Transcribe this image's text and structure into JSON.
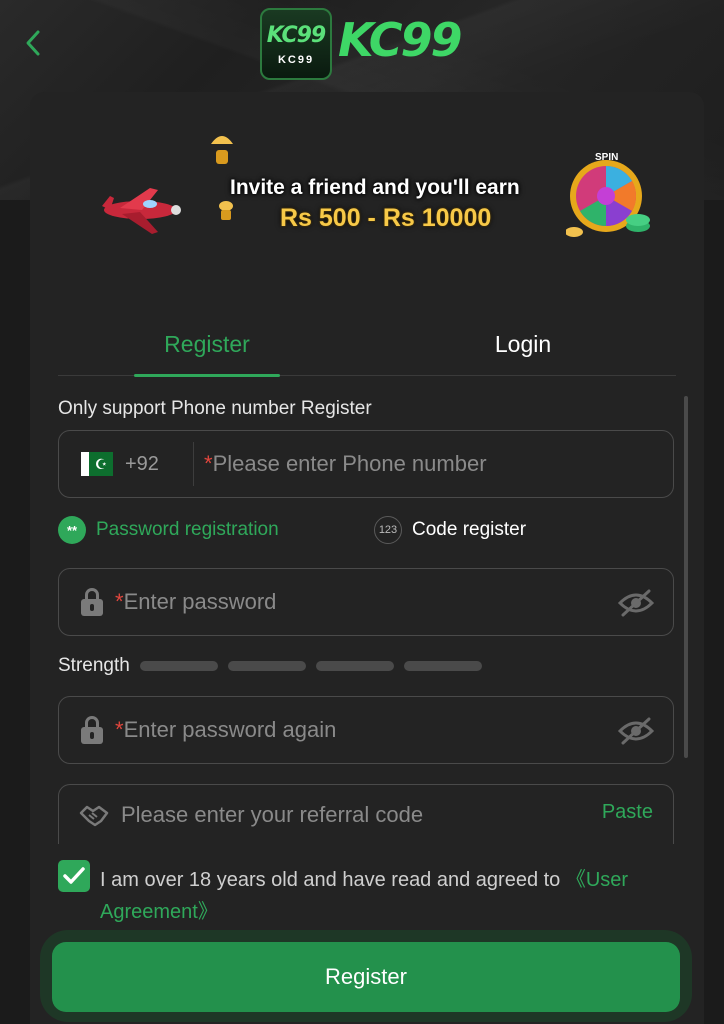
{
  "header": {
    "back_icon": "chevron-left-icon",
    "logo_badge": "KC99",
    "logo_badge_sub": "KC99",
    "logo_text": "KC99"
  },
  "banner": {
    "line1": "Invite a friend and you'll earn",
    "line2": "Rs 500 - Rs 10000",
    "wheel_label": "SPIN"
  },
  "tabs": [
    {
      "label": "Register",
      "active": true
    },
    {
      "label": "Login",
      "active": false
    }
  ],
  "form": {
    "section_label": "Only support Phone number Register",
    "phone": {
      "country_code": "+92",
      "placeholder_req": "*",
      "placeholder": "Please enter Phone number"
    },
    "modes": {
      "password": {
        "label": "Password registration",
        "icon_text": "**",
        "active": true
      },
      "code": {
        "label": "Code register",
        "icon_text": "123",
        "active": false
      }
    },
    "password": {
      "placeholder_req": "*",
      "placeholder": "Enter password"
    },
    "strength": {
      "label": "Strength",
      "level": 0,
      "segments": 4
    },
    "password_again": {
      "placeholder_req": "*",
      "placeholder": "Enter password again"
    },
    "referral": {
      "placeholder": "Please enter your referral code",
      "paste_label": "Paste"
    },
    "agreement": {
      "checked": true,
      "text": "I am over 18 years old and have read and agreed to ",
      "link": "《User Agreement》"
    },
    "submit_label": "Register"
  },
  "colors": {
    "accent": "#2fa85a",
    "background": "#1b1b1b",
    "card": "#232323",
    "required": "#e0463d"
  }
}
